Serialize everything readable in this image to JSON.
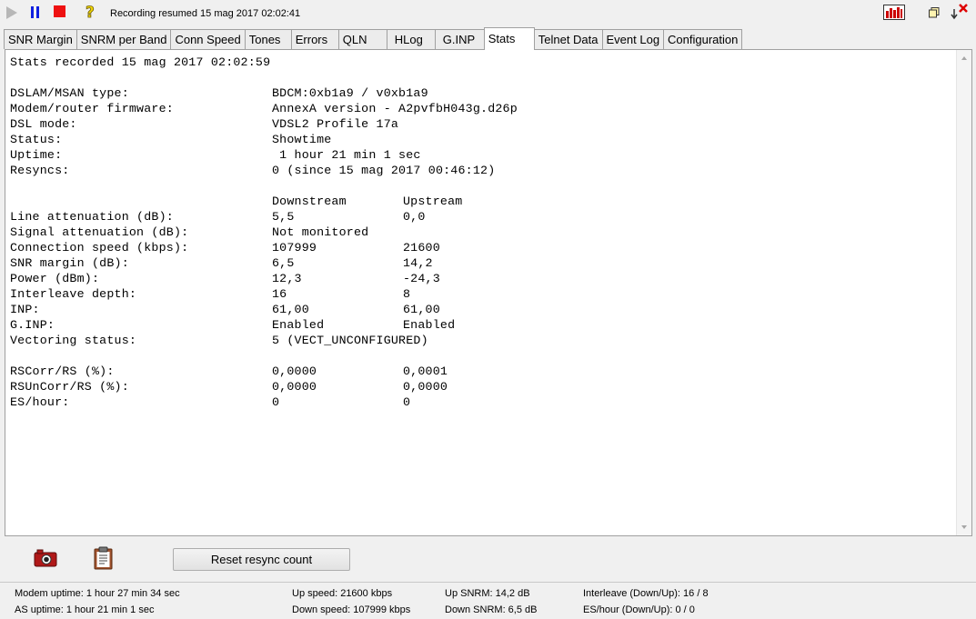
{
  "toolbar": {
    "status_message": "Recording resumed 15 mag 2017 02:02:41",
    "icons": [
      "play-icon",
      "pause-icon",
      "stop-icon",
      "hint-icon",
      "graph-icon",
      "restore-icon",
      "close-icon"
    ]
  },
  "tabs": [
    {
      "label": "SNR Margin"
    },
    {
      "label": "SNRM per Band"
    },
    {
      "label": "Conn Speed"
    },
    {
      "label": "Tones"
    },
    {
      "label": "Errors"
    },
    {
      "label": "QLN"
    },
    {
      "label": "HLog"
    },
    {
      "label": "G.INP"
    },
    {
      "label": "Stats",
      "active": true
    },
    {
      "label": "Telnet Data"
    },
    {
      "label": "Event Log"
    },
    {
      "label": "Configuration"
    }
  ],
  "stats": {
    "header": "Stats recorded 15 mag 2017 02:02:59",
    "info": [
      {
        "label": "DSLAM/MSAN type:",
        "value": "BDCM:0xb1a9 / v0xb1a9"
      },
      {
        "label": "Modem/router firmware:",
        "value": "AnnexA version - A2pvfbH043g.d26p"
      },
      {
        "label": "DSL mode:",
        "value": "VDSL2 Profile 17a"
      },
      {
        "label": "Status:",
        "value": "Showtime"
      },
      {
        "label": "Uptime:",
        "value": " 1 hour 21 min 1 sec"
      },
      {
        "label": "Resyncs:",
        "value": "0 (since 15 mag 2017 00:46:12)"
      }
    ],
    "col_down": "Downstream",
    "col_up": "Upstream",
    "line": [
      {
        "label": "Line attenuation (dB):",
        "down": "5,5",
        "up": "0,0"
      },
      {
        "label": "Signal attenuation (dB):",
        "down": "Not monitored",
        "up": ""
      },
      {
        "label": "Connection speed (kbps):",
        "down": "107999",
        "up": "21600"
      },
      {
        "label": "SNR margin (dB):",
        "down": "6,5",
        "up": "14,2"
      },
      {
        "label": "Power (dBm):",
        "down": "12,3",
        "up": "-24,3"
      },
      {
        "label": "Interleave depth:",
        "down": "16",
        "up": "8"
      },
      {
        "label": "INP:",
        "down": "61,00",
        "up": "61,00"
      },
      {
        "label": "G.INP:",
        "down": "Enabled",
        "up": "Enabled"
      },
      {
        "label": "Vectoring status:",
        "down": "5 (VECT_UNCONFIGURED)",
        "up": ""
      }
    ],
    "errors": [
      {
        "label": "RSCorr/RS (%):",
        "down": "0,0000",
        "up": "0,0001"
      },
      {
        "label": "RSUnCorr/RS (%):",
        "down": "0,0000",
        "up": "0,0000"
      },
      {
        "label": "ES/hour:",
        "down": "0",
        "up": "0"
      }
    ]
  },
  "actions": {
    "reset_label": "Reset resync count",
    "icons": [
      "camera-icon",
      "clipboard-icon"
    ]
  },
  "statusbar": {
    "modem_uptime": "Modem uptime:  1 hour 27 min 34 sec",
    "as_uptime": "AS uptime:  1 hour 21 min 1 sec",
    "up_speed": "Up speed: 21600 kbps",
    "down_speed": "Down speed: 107999 kbps",
    "up_snrm": "Up SNRM: 14,2 dB",
    "down_snrm": "Down SNRM: 6,5 dB",
    "interleave": "Interleave (Down/Up): 16 / 8",
    "es_hour": "ES/hour (Down/Up): 0 / 0"
  }
}
